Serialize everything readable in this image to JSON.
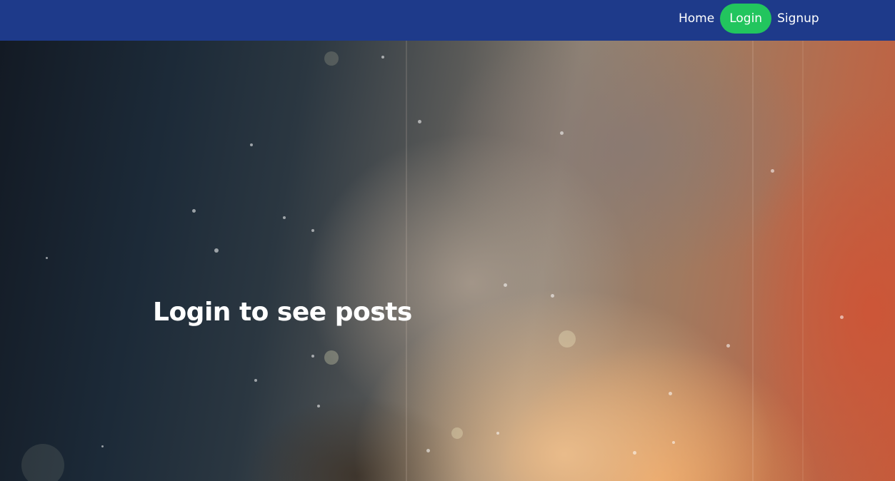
{
  "nav": {
    "items": [
      {
        "label": "Home",
        "active": false
      },
      {
        "label": "Login",
        "active": true
      },
      {
        "label": "Signup",
        "active": false
      }
    ]
  },
  "hero": {
    "heading": "Login to see posts"
  },
  "colors": {
    "navbar": "#1e3a8a",
    "active_pill": "#22c55e",
    "text": "#ffffff"
  }
}
